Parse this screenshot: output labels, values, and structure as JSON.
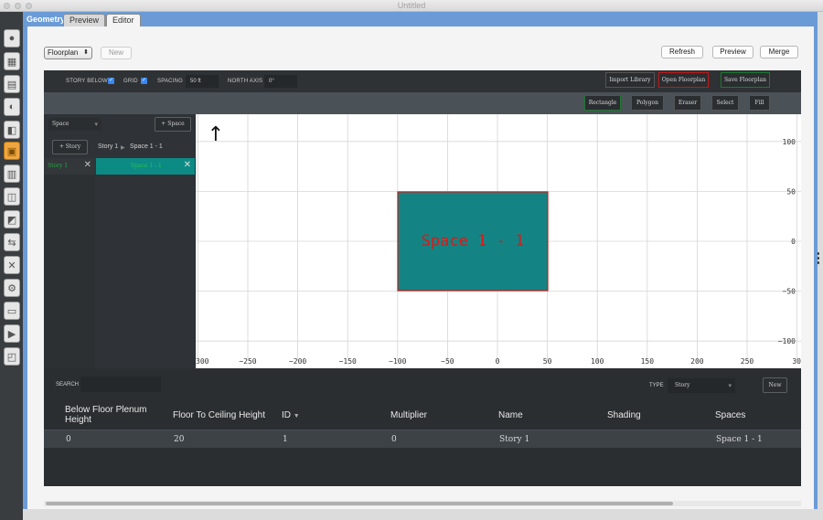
{
  "window": {
    "title": "Untitled"
  },
  "tabs": {
    "geometry": "Geometry",
    "preview": "Preview",
    "editor": "Editor"
  },
  "topbar": {
    "mode_select": "Floorplan",
    "new": "New",
    "refresh": "Refresh",
    "preview": "Preview",
    "merge": "Merge"
  },
  "toolbar1": {
    "story_below": "STORY BELOW",
    "grid": "GRID",
    "spacing": "SPACING",
    "spacing_value": "50 ft",
    "north_axis": "NORTH AXIS",
    "north_axis_value": "0°",
    "import_library": "Import Library",
    "open_floorplan": "Open Floorplan",
    "save_floorplan": "Save Floorplan"
  },
  "toolbar2": {
    "rectangle": "Rectangle",
    "polygon": "Polygon",
    "eraser": "Eraser",
    "select": "Select",
    "fill": "Fill"
  },
  "sidebar": {
    "type_select": "Space",
    "add_space": "Space",
    "add_story": "Story",
    "breadcrumb_story": "Story 1",
    "breadcrumb_sep": "▶",
    "breadcrumb_space": "Space 1 - 1",
    "story_item": "Story 1",
    "space_item": "Space 1 - 1",
    "close_glyph": "✕"
  },
  "canvas": {
    "space_label": "Space 1 - 1",
    "x_ticks": [
      "300",
      "−250",
      "−200",
      "−150",
      "−100",
      "−50",
      "0",
      "50",
      "100",
      "150",
      "200",
      "250",
      "30"
    ],
    "y_ticks": [
      "100",
      "50",
      "0",
      "−50",
      "−100"
    ],
    "colors": {
      "space_fill": "#138483",
      "space_stroke": "#c0201c",
      "label": "#e51515"
    }
  },
  "bottom": {
    "search_label": "SEARCH",
    "type_label": "TYPE",
    "type_value": "Story",
    "new": "New",
    "columns": [
      "Below Floor Plenum Height",
      "Floor To Ceiling Height",
      "ID",
      "Multiplier",
      "Name",
      "Shading",
      "Spaces"
    ],
    "rows": [
      {
        "below_floor_plenum_height": "0",
        "floor_to_ceiling_height": "20",
        "id": "1",
        "multiplier": "0",
        "name": "Story 1",
        "shading": "",
        "spaces": "Space 1 - 1"
      }
    ]
  },
  "icons": {
    "north_arrow": "↑",
    "plus": "+",
    "dropdown": "▾",
    "sort": "▼"
  }
}
